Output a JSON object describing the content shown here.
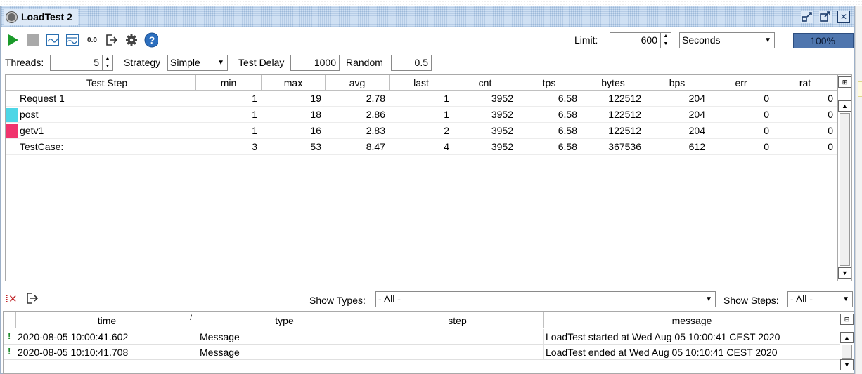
{
  "window": {
    "title": "LoadTest 2"
  },
  "toolbar": {
    "icons": [
      "play-icon",
      "stop-icon",
      "chart-icon",
      "statistics-icon",
      "reset-icon",
      "export-icon",
      "gear-icon",
      "help-icon"
    ],
    "reset_label": "0.0",
    "limit_label": "Limit:",
    "limit_value": "600",
    "limit_unit": "Seconds",
    "progress_percent": 100,
    "progress_label": "100%"
  },
  "settings": {
    "threads_label": "Threads:",
    "threads_value": "5",
    "strategy_label": "Strategy",
    "strategy_value": "Simple",
    "test_delay_label": "Test Delay",
    "test_delay_value": "1000",
    "random_label": "Random",
    "random_value": "0.5"
  },
  "stats": {
    "columns": [
      "Test Step",
      "min",
      "max",
      "avg",
      "last",
      "cnt",
      "tps",
      "bytes",
      "bps",
      "err",
      "rat"
    ],
    "rows": [
      {
        "color": "",
        "step": "Request 1",
        "min": "1",
        "max": "19",
        "avg": "2.78",
        "last": "1",
        "cnt": "3952",
        "tps": "6.58",
        "bytes": "122512",
        "bps": "204",
        "err": "0",
        "rat": "0"
      },
      {
        "color": "#4dd6e6",
        "step": "post",
        "min": "1",
        "max": "18",
        "avg": "2.86",
        "last": "1",
        "cnt": "3952",
        "tps": "6.58",
        "bytes": "122512",
        "bps": "204",
        "err": "0",
        "rat": "0"
      },
      {
        "color": "#f0346d",
        "step": "getv1",
        "min": "1",
        "max": "16",
        "avg": "2.83",
        "last": "2",
        "cnt": "3952",
        "tps": "6.58",
        "bytes": "122512",
        "bps": "204",
        "err": "0",
        "rat": "0"
      },
      {
        "color": "",
        "step": "TestCase:",
        "min": "3",
        "max": "53",
        "avg": "8.47",
        "last": "4",
        "cnt": "3952",
        "tps": "6.58",
        "bytes": "367536",
        "bps": "612",
        "err": "0",
        "rat": "0"
      }
    ]
  },
  "log": {
    "show_types_label": "Show Types:",
    "show_types_value": "- All -",
    "show_steps_label": "Show Steps:",
    "show_steps_value": "- All -",
    "columns": [
      "time",
      "type",
      "step",
      "message"
    ],
    "sort_indicator": "/",
    "rows": [
      {
        "time": "2020-08-05 10:00:41.602",
        "type": "Message",
        "step": "",
        "message": "LoadTest started at Wed Aug 05 10:00:41 CEST 2020"
      },
      {
        "time": "2020-08-05 10:10:41.708",
        "type": "Message",
        "step": "",
        "message": "LoadTest ended at Wed Aug 05 10:10:41 CEST 2020"
      }
    ]
  }
}
